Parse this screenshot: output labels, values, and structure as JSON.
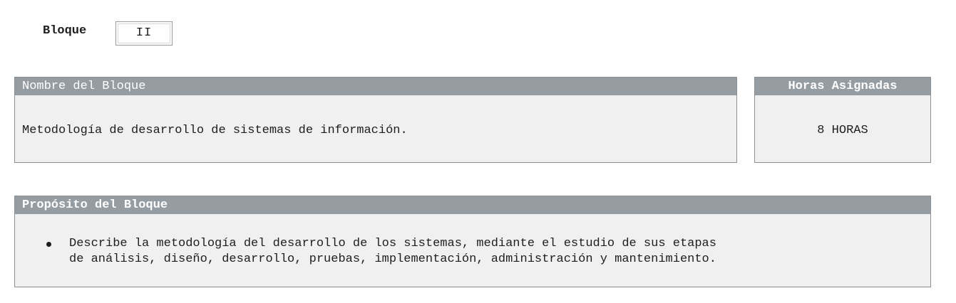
{
  "bloque": {
    "label": "Bloque",
    "value": "II"
  },
  "nombre": {
    "header": "Nombre del Bloque",
    "text": "Metodología de desarrollo de sistemas de información."
  },
  "horas": {
    "header": "Horas Asignadas",
    "value": "8 HORAS"
  },
  "proposito": {
    "header": "Propósito del Bloque",
    "items": [
      {
        "line1": "Describe la metodología del desarrollo de los sistemas, mediante el estudio de sus etapas",
        "line2": "de análisis, diseño, desarrollo, pruebas, implementación, administración y mantenimiento."
      }
    ]
  },
  "colors": {
    "header_bg": "#959ca2",
    "panel_bg": "#f0f0f0",
    "border": "#8a8f94"
  }
}
